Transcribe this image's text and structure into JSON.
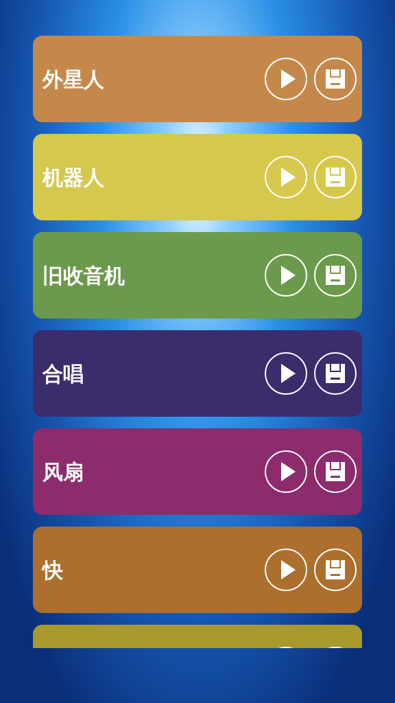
{
  "effects": [
    {
      "name": "外星人",
      "color": "#c4894a"
    },
    {
      "name": "机器人",
      "color": "#d6c84c"
    },
    {
      "name": "旧收音机",
      "color": "#6c9a4c"
    },
    {
      "name": "合唱",
      "color": "#3b2c6c"
    },
    {
      "name": "风扇",
      "color": "#8c2c6c"
    },
    {
      "name": "快",
      "color": "#ad6f2e"
    },
    {
      "color": "#a89a2a"
    }
  ]
}
